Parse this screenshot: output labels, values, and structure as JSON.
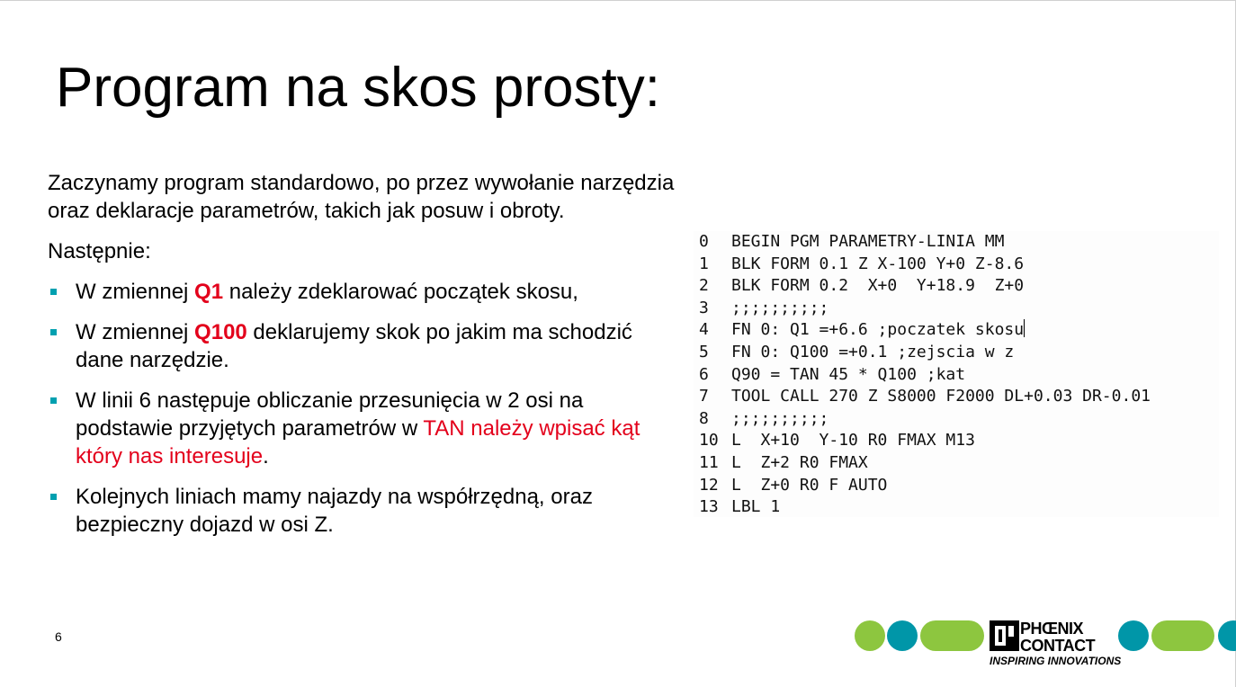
{
  "slide": {
    "title": "Program na skos prosty:",
    "intro": "Zaczynamy program standardowo, po przez wywołanie narzędzia oraz deklaracje parametrów, takich jak posuw i obroty.",
    "next_label": "Następnie:",
    "bullets": [
      {
        "a": "W zmiennej ",
        "b": "Q1",
        "c": " należy zdeklarować początek skosu,"
      },
      {
        "a": "W zmiennej ",
        "b": "Q100",
        "c": " deklarujemy skok po jakim ma schodzić dane narzędzie."
      },
      {
        "a": "W linii 6 następuje obliczanie przesunięcia w 2 osi na podstawie przyjętych parametrów w ",
        "b": "TAN należy wpisać kąt który nas interesuje",
        "c": "."
      },
      {
        "a": "Kolejnych liniach mamy najazdy na współrzędną, oraz bezpieczny dojazd w osi Z."
      }
    ],
    "page_number": "6"
  },
  "code": {
    "lines": [
      {
        "num": "0",
        "text": "BEGIN PGM PARAMETRY-LINIA MM"
      },
      {
        "num": "1",
        "text": "BLK FORM 0.1 Z X-100 Y+0 Z-8.6"
      },
      {
        "num": "2",
        "text": "BLK FORM 0.2  X+0  Y+18.9  Z+0"
      },
      {
        "num": "3",
        "text": ";;;;;;;;;;"
      },
      {
        "num": "4",
        "text": "FN 0: Q1 =+6.6 ;poczatek skosu"
      },
      {
        "num": "5",
        "text": "FN 0: Q100 =+0.1 ;zejscia w z"
      },
      {
        "num": "6",
        "text": "Q90 = TAN 45 * Q100 ;kat"
      },
      {
        "num": "7",
        "text": "TOOL CALL 270 Z S8000 F2000 DL+0.03 DR-0.01"
      },
      {
        "num": "8",
        "text": ";;;;;;;;;;"
      },
      {
        "num": "10",
        "text": "L  X+10  Y-10 R0 FMAX M13"
      },
      {
        "num": "11",
        "text": "L  Z+2 R0 FMAX"
      },
      {
        "num": "12",
        "text": "L  Z+0 R0 F AUTO"
      },
      {
        "num": "13",
        "text": "LBL 1"
      }
    ]
  },
  "logo": {
    "brand_line1": "PHŒNIX",
    "brand_line2": "CONTACT",
    "tagline": "INSPIRING INNOVATIONS",
    "colors": {
      "green": "#8dc63f",
      "teal": "#0096a8"
    }
  },
  "colors": {
    "accent_red": "#e3001b",
    "bullet_teal": "#00a0b0"
  }
}
